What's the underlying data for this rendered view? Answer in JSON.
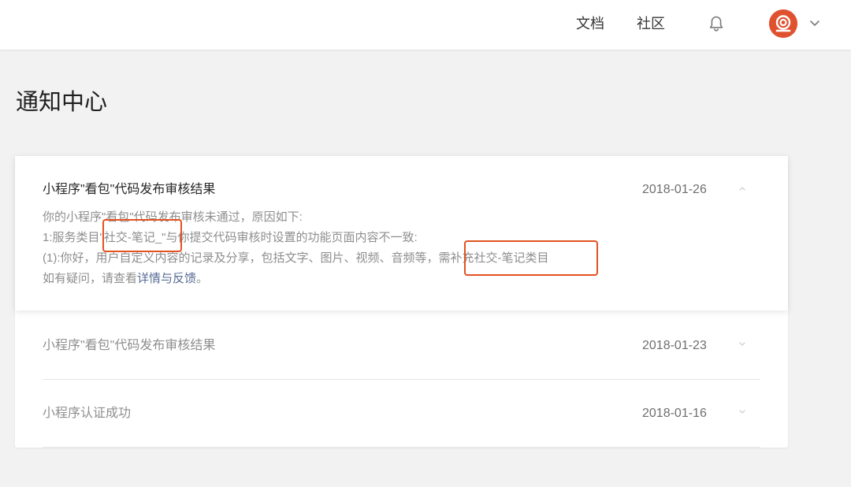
{
  "header": {
    "nav_docs": "文档",
    "nav_community": "社区",
    "bell_icon": "bell-icon",
    "avatar_icon": "user-avatar",
    "menu_icon": "chevron-down-icon"
  },
  "page": {
    "title": "通知中心"
  },
  "notifications": [
    {
      "title": "小程序\"看包\"代码发布审核结果",
      "date": "2018-01-26",
      "expanded": true,
      "body": {
        "line1": "你的小程序\"看包\"代码发布审核未通过，原因如下:",
        "line2": "1:服务类目\"社交-笔记_\"与你提交代码审核时设置的功能页面内容不一致:",
        "line3": "(1):你好，用户自定义内容的记录及分享，包括文字、图片、视频、音频等，需补充社交-笔记类目",
        "line4_prefix": "如有疑问，请查看",
        "line4_link": "详情与反馈",
        "line4_suffix": "。"
      }
    },
    {
      "title": "小程序\"看包\"代码发布审核结果",
      "date": "2018-01-23",
      "expanded": false
    },
    {
      "title": "小程序认证成功",
      "date": "2018-01-16",
      "expanded": false
    }
  ],
  "colors": {
    "background": "#f2f2f2",
    "card": "#ffffff",
    "highlight": "#e35221",
    "link": "#576b95",
    "avatar": "#e0522f"
  }
}
